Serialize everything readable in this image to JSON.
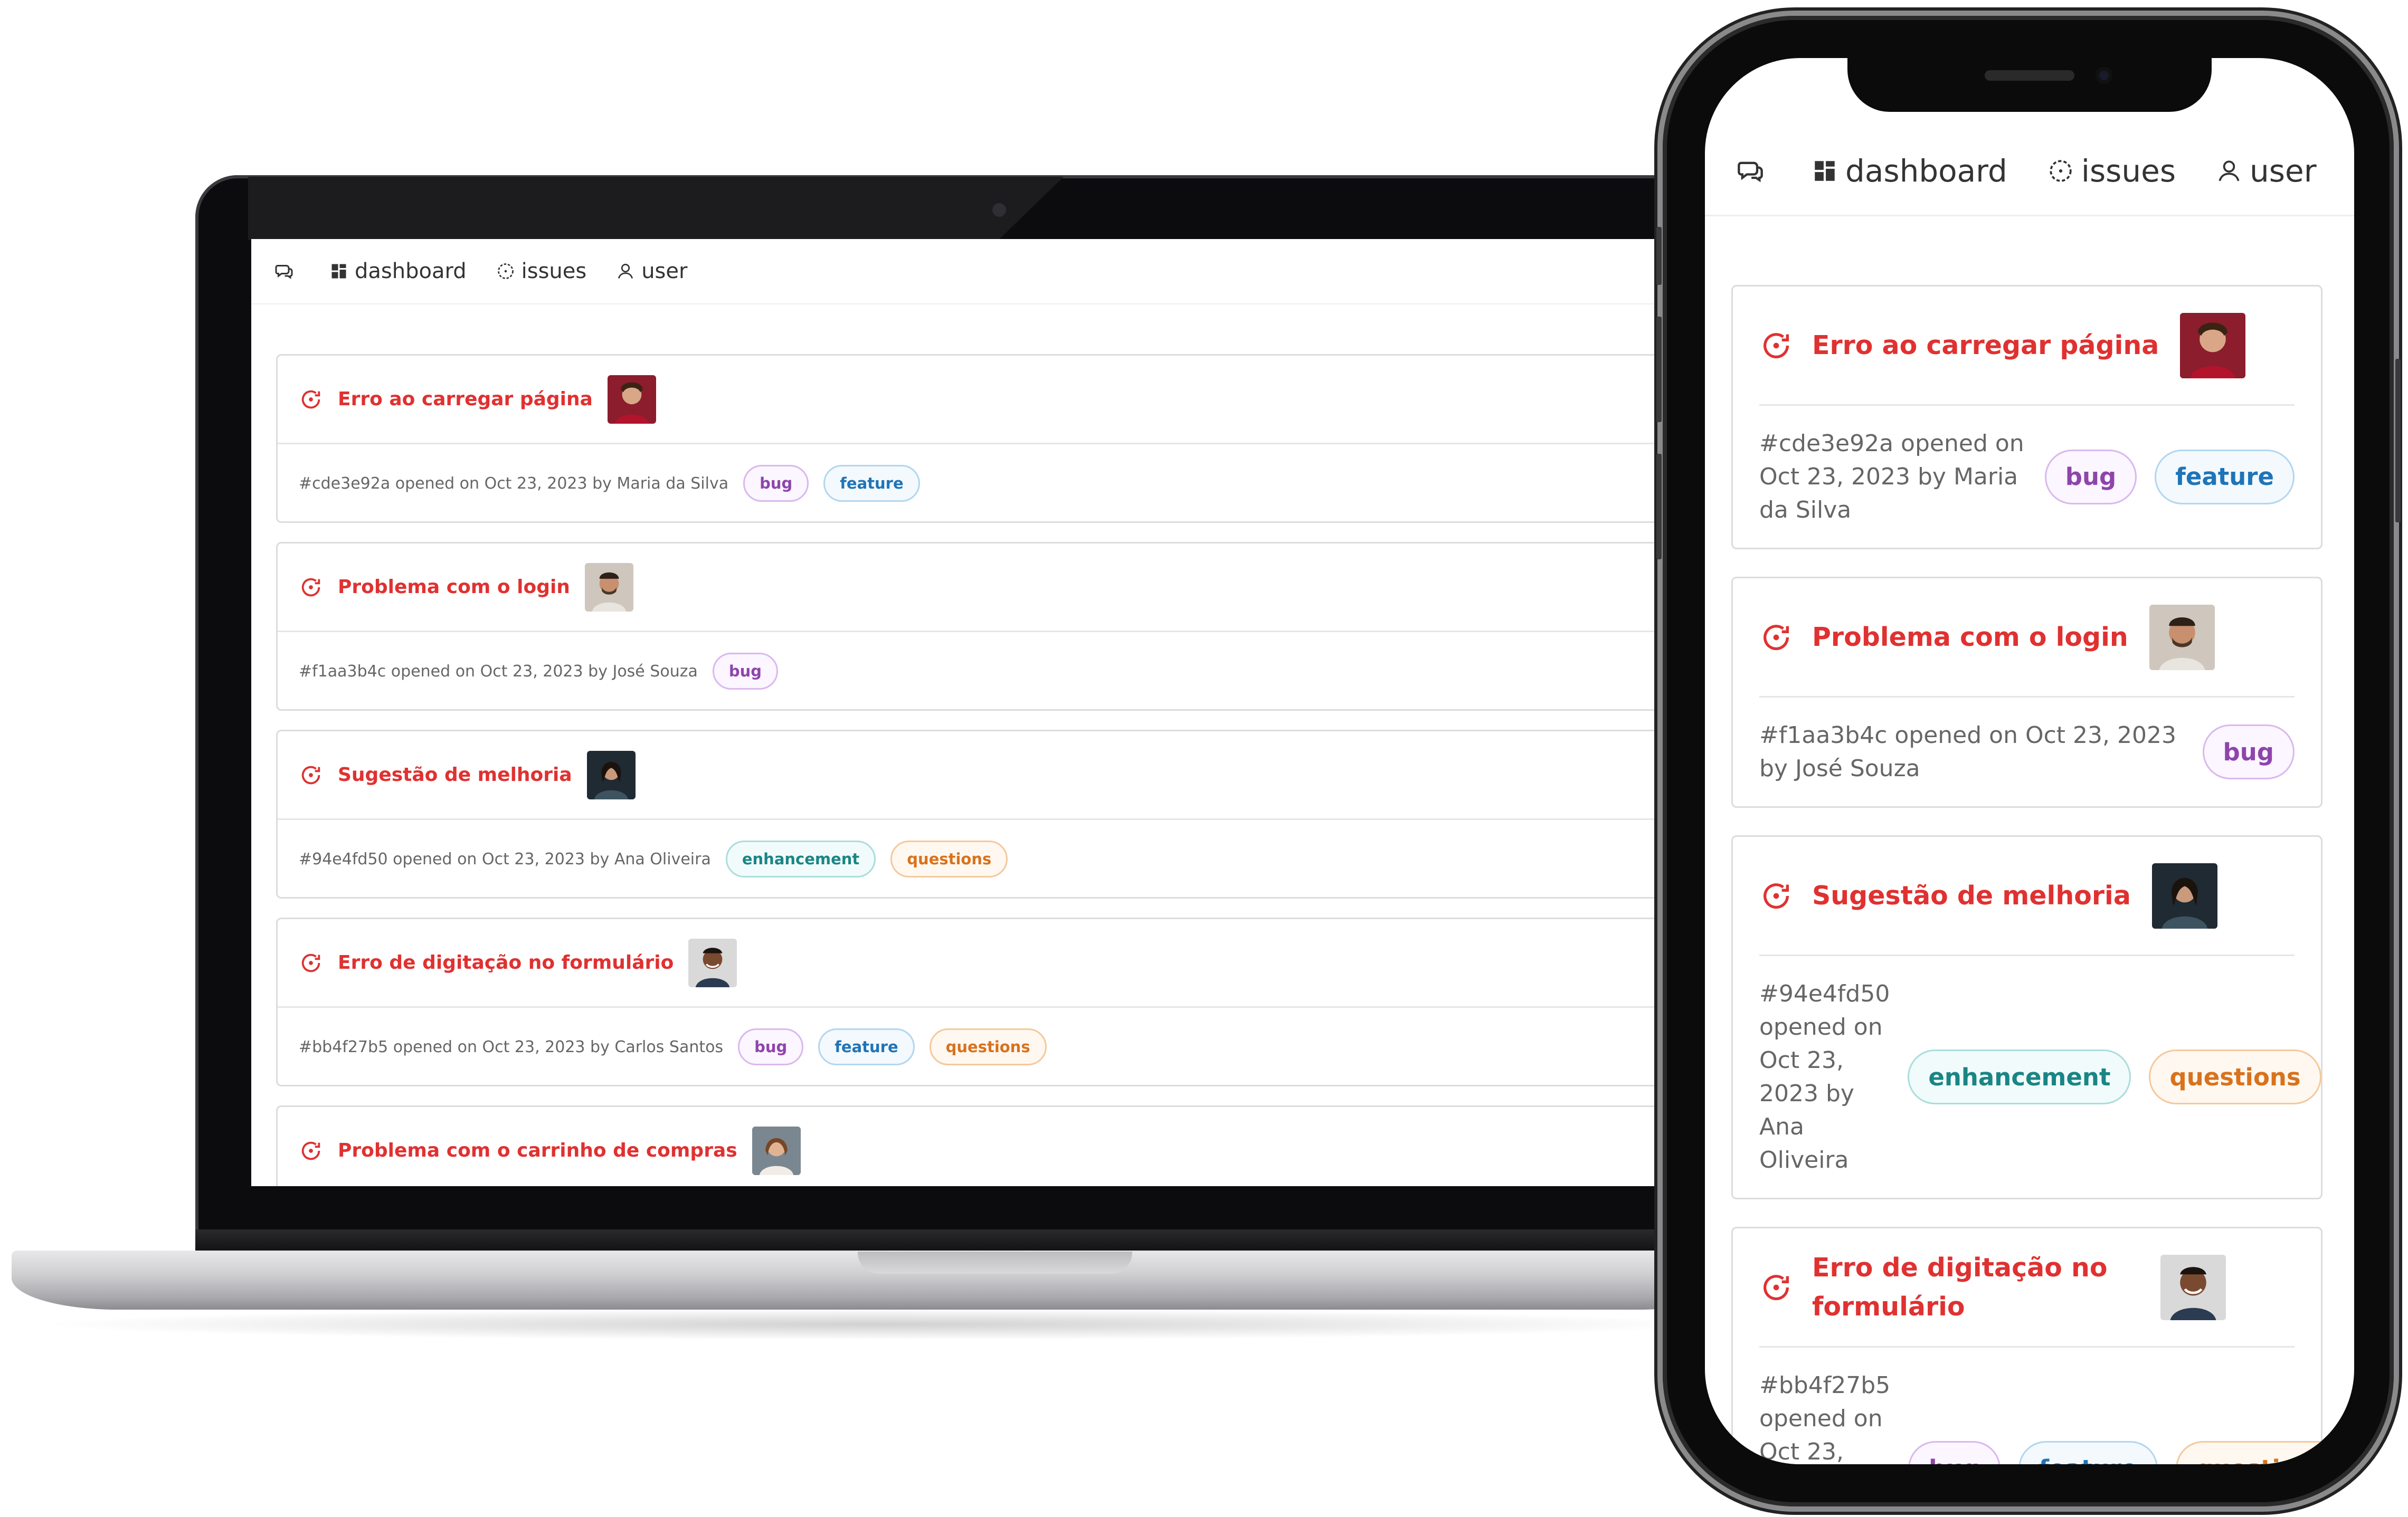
{
  "nav": {
    "dashboard": "dashboard",
    "issues": "issues",
    "user": "user"
  },
  "issues": [
    {
      "title": "Erro ao carregar página",
      "meta": "#cde3e92a opened on Oct 23, 2023 by Maria da Silva",
      "labels": [
        "bug",
        "feature"
      ],
      "avatar_bg": "#8b1d2c"
    },
    {
      "title": "Problema com o login",
      "meta": "#f1aa3b4c opened on Oct 23, 2023 by José Souza",
      "labels": [
        "bug"
      ],
      "avatar_bg": "#cfc7bd"
    },
    {
      "title": "Sugestão de melhoria",
      "meta": "#94e4fd50 opened on Oct 23, 2023 by Ana Oliveira",
      "labels": [
        "enhancement",
        "questions"
      ],
      "avatar_bg": "#1f2a33"
    },
    {
      "title": "Erro de digitação no formulário",
      "meta": "#bb4f27b5 opened on Oct 23, 2023 by Carlos Santos",
      "labels": [
        "bug",
        "feature",
        "questions"
      ],
      "avatar_bg": "#d9d9d9"
    },
    {
      "title": "Problema com o carrinho de compras",
      "meta": "",
      "labels": [],
      "avatar_bg": "#7a8790"
    }
  ],
  "colors": {
    "title_red": "#e03131",
    "bug": "#8e44ad",
    "feature": "#1f74b8",
    "enhancement": "#1a8585",
    "questions": "#d9721c"
  },
  "icons": {
    "logo": "chat-bubbles-icon",
    "dashboard": "dashboard-grid-icon",
    "issues": "issue-circle-icon",
    "user": "user-icon",
    "issue": "issue-opened-icon"
  }
}
